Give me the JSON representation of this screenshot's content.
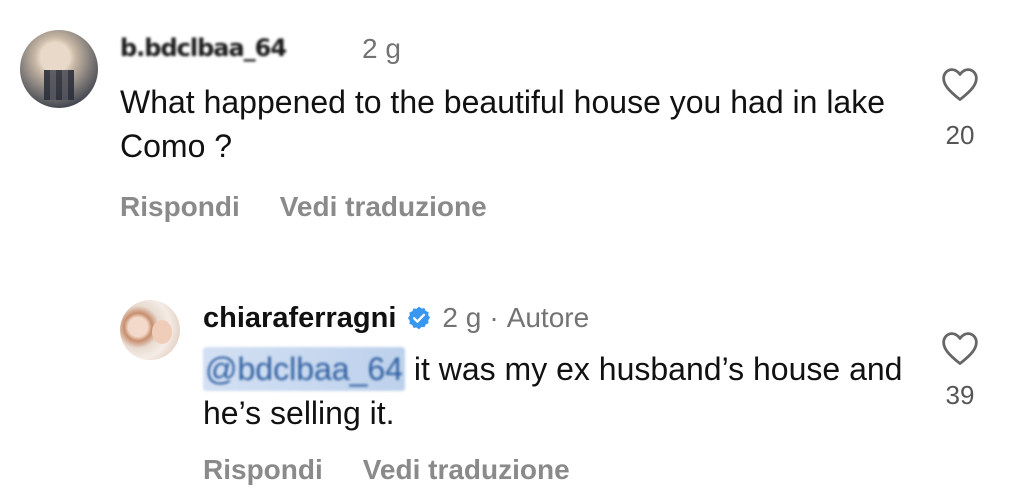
{
  "comments": [
    {
      "username": "b.bdclbaa_64",
      "time": "2 g",
      "text": "What happened to the beautiful house you had in lake Como ?",
      "likes": "20",
      "reply_label": "Rispondi",
      "translate_label": "Vedi traduzione"
    },
    {
      "username": "chiaraferragni",
      "verified": true,
      "time": "2 g",
      "separator": "·",
      "author_label": "Autore",
      "mention": "@bdclbaa_64",
      "text": " it was my ex husband’s house and he’s selling it.",
      "likes": "39",
      "reply_label": "Rispondi",
      "translate_label": "Vedi traduzione"
    }
  ],
  "icons": {
    "like": "heart-outline-icon",
    "verified": "verified-badge-icon"
  },
  "colors": {
    "verified": "#3897f0",
    "secondary_text": "#737373",
    "mention": "#2f5fa0"
  }
}
